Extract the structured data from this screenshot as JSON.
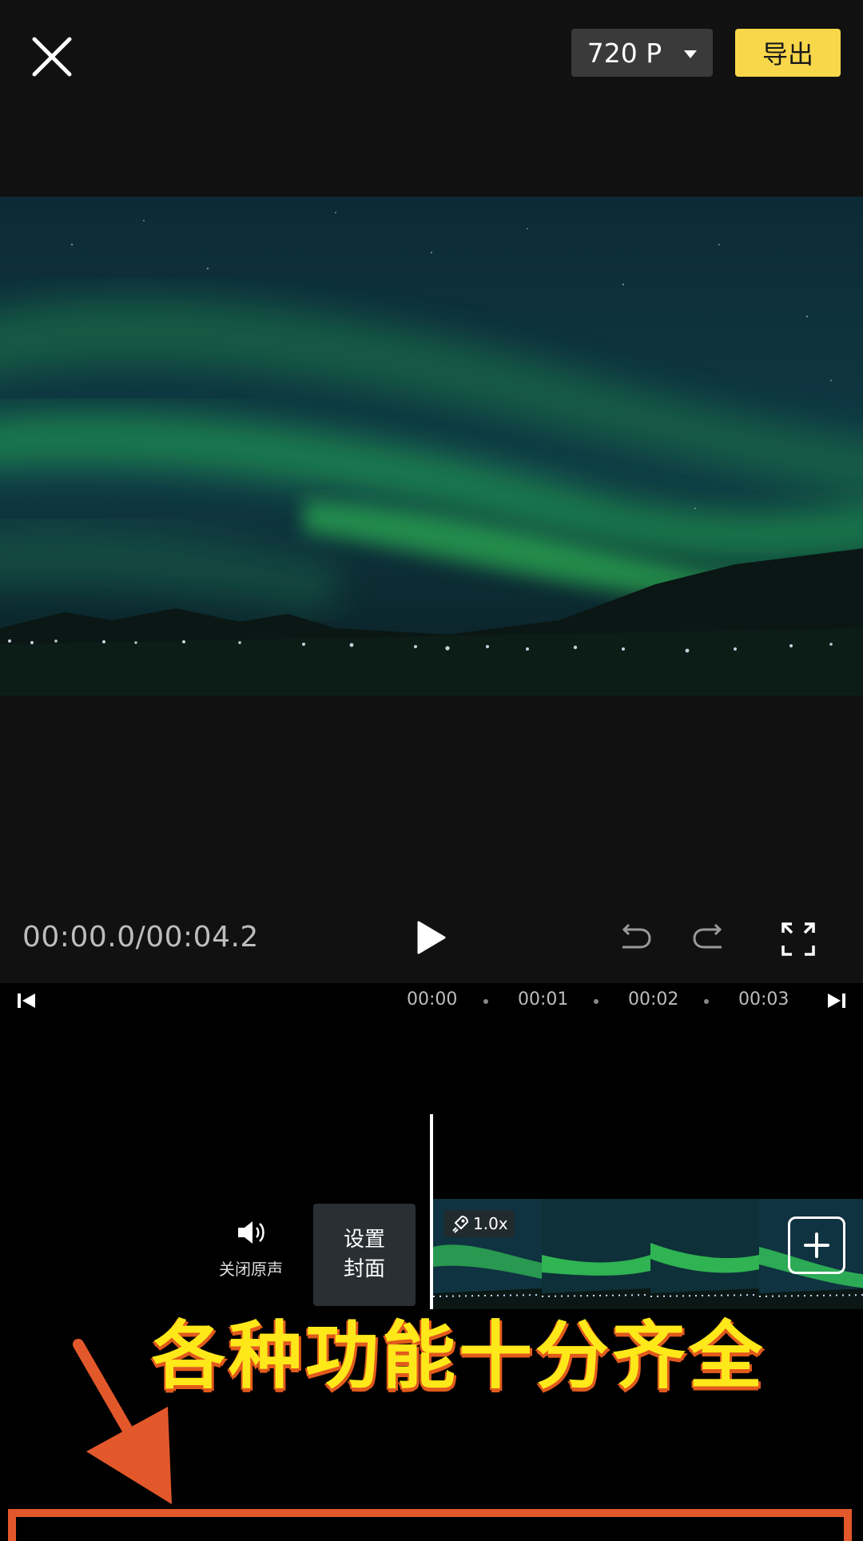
{
  "header": {
    "resolution_label": "720 P",
    "export_label": "导出"
  },
  "player": {
    "timecode": "00:00.0/00:04.2"
  },
  "ruler": {
    "ticks": [
      "00:00",
      "00:01",
      "00:02",
      "00:03"
    ]
  },
  "track": {
    "mute_label": "关闭原声",
    "cover_line1": "设置",
    "cover_line2": "封面",
    "speed_badge": "1.0x"
  },
  "overlay": {
    "caption": "各种功能十分齐全"
  },
  "colors": {
    "accent": "#f9d74a",
    "caption": "#ffe81a",
    "caption_outline": "#e25a1c",
    "arrow": "#e3582b"
  },
  "icons": [
    "close-icon",
    "chevron-down-icon",
    "play-icon",
    "undo-icon",
    "redo-icon",
    "fullscreen-icon",
    "jump-start-icon",
    "jump-end-icon",
    "speaker-icon",
    "rocket-icon",
    "plus-icon",
    "arrow-icon"
  ]
}
